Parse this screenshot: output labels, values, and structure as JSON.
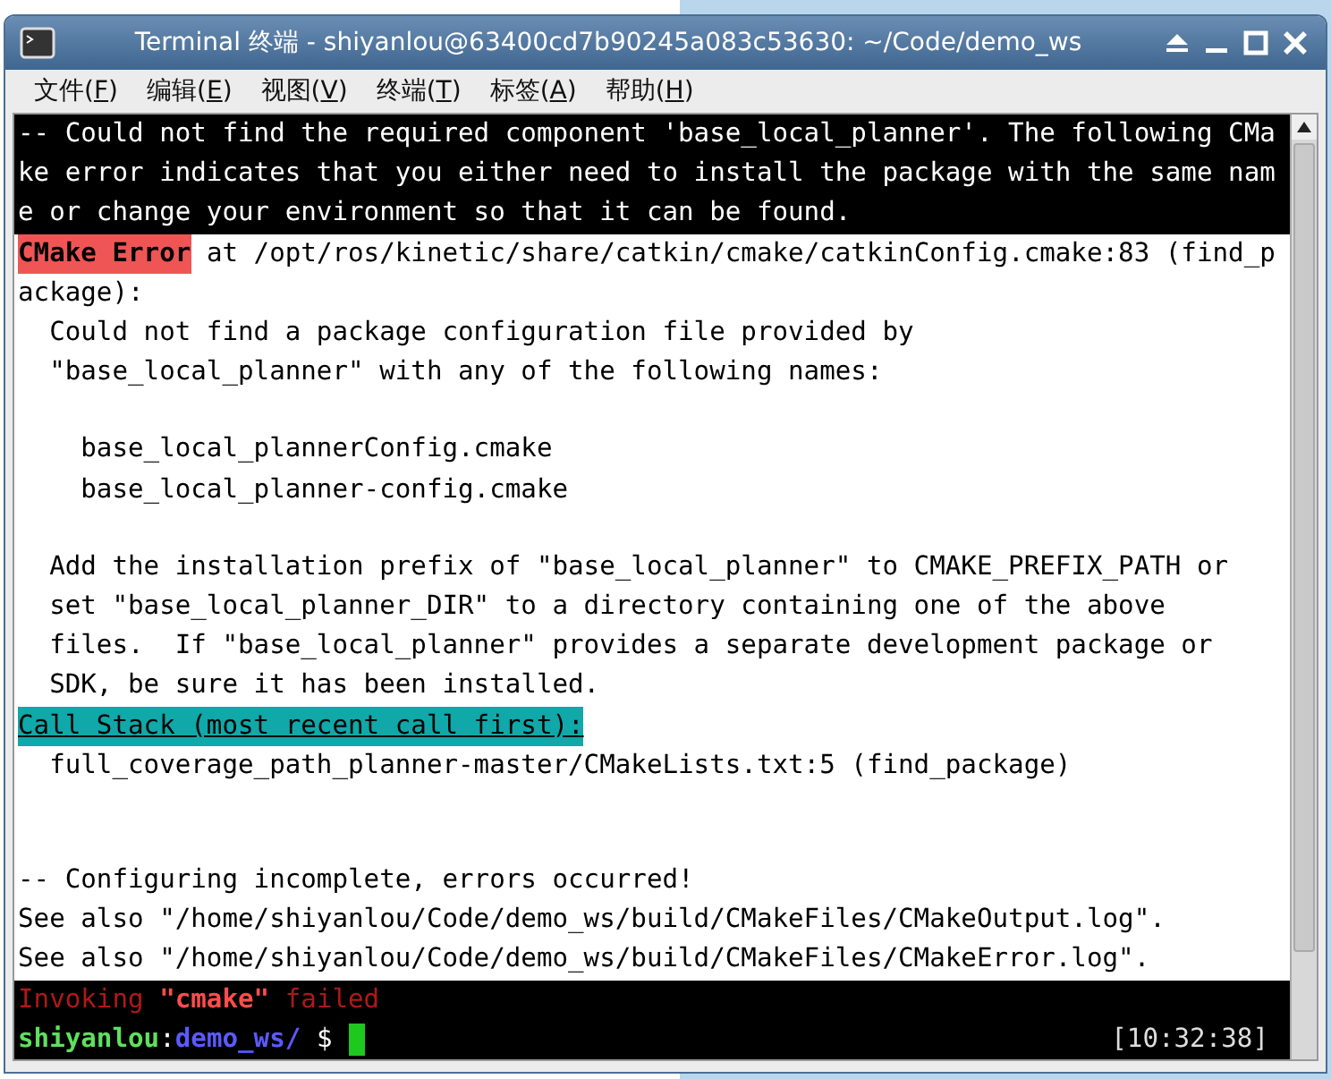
{
  "window": {
    "title": "Terminal 终端 - shiyanlou@63400cd7b90245a083c53630: ~/Code/demo_ws"
  },
  "menu": [
    {
      "label": "文件(F)"
    },
    {
      "label": "编辑(E)"
    },
    {
      "label": "视图(V)"
    },
    {
      "label": "终端(T)"
    },
    {
      "label": "标签(A)"
    },
    {
      "label": "帮助(H)"
    }
  ],
  "terminal": {
    "lines": [
      {
        "kind": "status",
        "spans": [
          {
            "kind": "text",
            "text": "-- Could not find the required component 'base_local_planner'. The following CMa"
          }
        ]
      },
      {
        "kind": "status",
        "spans": [
          {
            "kind": "text",
            "text": "ke error indicates that you either need to install the package with the same nam"
          }
        ]
      },
      {
        "kind": "status",
        "spans": [
          {
            "kind": "text",
            "text": "e or change your environment so that it can be found."
          }
        ]
      },
      {
        "kind": "output",
        "spans": [
          {
            "kind": "error",
            "text": "CMake Error"
          },
          {
            "kind": "text",
            "text": " at /opt/ros/kinetic/share/catkin/cmake/catkinConfig.cmake:83 (find_p"
          }
        ]
      },
      {
        "kind": "output",
        "spans": [
          {
            "kind": "text",
            "text": "ackage):"
          }
        ]
      },
      {
        "kind": "output",
        "spans": [
          {
            "kind": "text",
            "text": "  Could not find a package configuration file provided by"
          }
        ]
      },
      {
        "kind": "output",
        "spans": [
          {
            "kind": "text",
            "text": "  \"base_local_planner\" with any of the following names:"
          }
        ]
      },
      {
        "kind": "output"
      },
      {
        "kind": "output",
        "spans": [
          {
            "kind": "text",
            "text": "    base_local_plannerConfig.cmake"
          }
        ]
      },
      {
        "kind": "output",
        "spans": [
          {
            "kind": "text",
            "text": "    base_local_planner-config.cmake"
          }
        ]
      },
      {
        "kind": "output"
      },
      {
        "kind": "output",
        "spans": [
          {
            "kind": "text",
            "text": "  Add the installation prefix of \"base_local_planner\" to CMAKE_PREFIX_PATH or"
          }
        ]
      },
      {
        "kind": "output",
        "spans": [
          {
            "kind": "text",
            "text": "  set \"base_local_planner_DIR\" to a directory containing one of the above"
          }
        ]
      },
      {
        "kind": "output",
        "spans": [
          {
            "kind": "text",
            "text": "  files.  If \"base_local_planner\" provides a separate development package or"
          }
        ]
      },
      {
        "kind": "output",
        "spans": [
          {
            "kind": "text",
            "text": "  SDK, be sure it has been installed."
          }
        ]
      },
      {
        "kind": "output",
        "spans": [
          {
            "kind": "heading",
            "text": "Call Stack (most recent call first):"
          }
        ]
      },
      {
        "kind": "output",
        "spans": [
          {
            "kind": "text",
            "text": "  full_coverage_path_planner-master/CMakeLists.txt:5 (find_package)"
          }
        ]
      },
      {
        "kind": "output"
      },
      {
        "kind": "output"
      },
      {
        "kind": "output",
        "spans": [
          {
            "kind": "text",
            "text": "-- Configuring incomplete, errors occurred!"
          }
        ]
      },
      {
        "kind": "output",
        "spans": [
          {
            "kind": "text",
            "text": "See also \"/home/shiyanlou/Code/demo_ws/build/CMakeFiles/CMakeOutput.log\"."
          }
        ]
      },
      {
        "kind": "output",
        "spans": [
          {
            "kind": "text",
            "text": "See also \"/home/shiyanlou/Code/demo_ws/build/CMakeFiles/CMakeError.log\"."
          }
        ]
      },
      {
        "kind": "status",
        "spans": [
          {
            "kind": "failure",
            "text": "Invoking "
          },
          {
            "kind": "quoted",
            "text": "\"cmake\""
          },
          {
            "kind": "failure",
            "text": " failed"
          }
        ]
      }
    ],
    "prompt": {
      "user": "shiyanlou",
      "separator": ":",
      "directory": "demo_ws/",
      "symbol": " $ ",
      "time": "[10:32:38]"
    }
  }
}
